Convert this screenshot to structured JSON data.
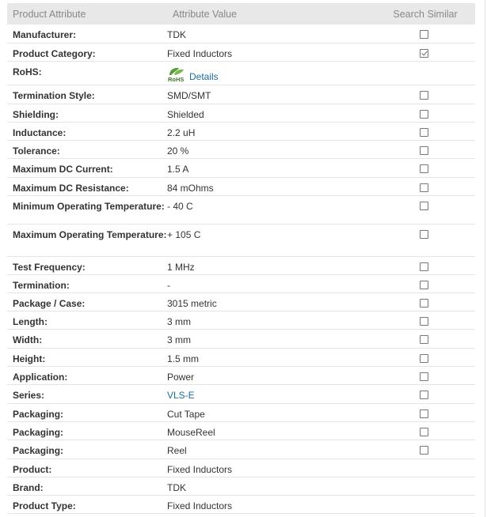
{
  "header": {
    "attribute_col": "Product Attribute",
    "value_col": "Attribute Value",
    "search_col": "Search Similar"
  },
  "rohs_logo_text": "RoHS",
  "rows": [
    {
      "attr": "Manufacturer:",
      "value": "TDK",
      "checkbox": true,
      "checked": false
    },
    {
      "attr": "Product Category:",
      "value": "Fixed Inductors",
      "checkbox": true,
      "checked": true
    },
    {
      "attr": "RoHS:",
      "value": "Details",
      "checkbox": false,
      "checked": false
    },
    {
      "attr": "Termination Style:",
      "value": "SMD/SMT",
      "checkbox": true,
      "checked": false
    },
    {
      "attr": "Shielding:",
      "value": "Shielded",
      "checkbox": true,
      "checked": false
    },
    {
      "attr": "Inductance:",
      "value": "2.2 uH",
      "checkbox": true,
      "checked": false
    },
    {
      "attr": "Tolerance:",
      "value": "20 %",
      "checkbox": true,
      "checked": false
    },
    {
      "attr": "Maximum DC Current:",
      "value": "1.5 A",
      "checkbox": true,
      "checked": false
    },
    {
      "attr": "Maximum DC Resistance:",
      "value": "84 mOhms",
      "checkbox": true,
      "checked": false
    },
    {
      "attr": "Minimum Operating Temperature:",
      "value": "- 40 C",
      "checkbox": true,
      "checked": false
    },
    {
      "attr": "Maximum Operating Temperature:",
      "value": "+ 105 C",
      "checkbox": true,
      "checked": false
    },
    {
      "attr": "Test Frequency:",
      "value": "1 MHz",
      "checkbox": true,
      "checked": false
    },
    {
      "attr": "Termination:",
      "value": "-",
      "checkbox": true,
      "checked": false
    },
    {
      "attr": "Package / Case:",
      "value": "3015 metric",
      "checkbox": true,
      "checked": false
    },
    {
      "attr": "Length:",
      "value": "3 mm",
      "checkbox": true,
      "checked": false
    },
    {
      "attr": "Width:",
      "value": "3 mm",
      "checkbox": true,
      "checked": false
    },
    {
      "attr": "Height:",
      "value": "1.5 mm",
      "checkbox": true,
      "checked": false
    },
    {
      "attr": "Application:",
      "value": "Power",
      "checkbox": true,
      "checked": false
    },
    {
      "attr": "Series:",
      "value": "VLS-E",
      "checkbox": true,
      "checked": false
    },
    {
      "attr": "Packaging:",
      "value": "Cut Tape",
      "checkbox": true,
      "checked": false
    },
    {
      "attr": "Packaging:",
      "value": "MouseReel",
      "checkbox": true,
      "checked": false
    },
    {
      "attr": "Packaging:",
      "value": "Reel",
      "checkbox": true,
      "checked": false
    },
    {
      "attr": "Product:",
      "value": "Fixed Inductors",
      "checkbox": false,
      "checked": false
    },
    {
      "attr": "Brand:",
      "value": "TDK",
      "checkbox": false,
      "checked": false
    },
    {
      "attr": "Product Type:",
      "value": "Fixed Inductors",
      "checkbox": false,
      "checked": false
    }
  ]
}
